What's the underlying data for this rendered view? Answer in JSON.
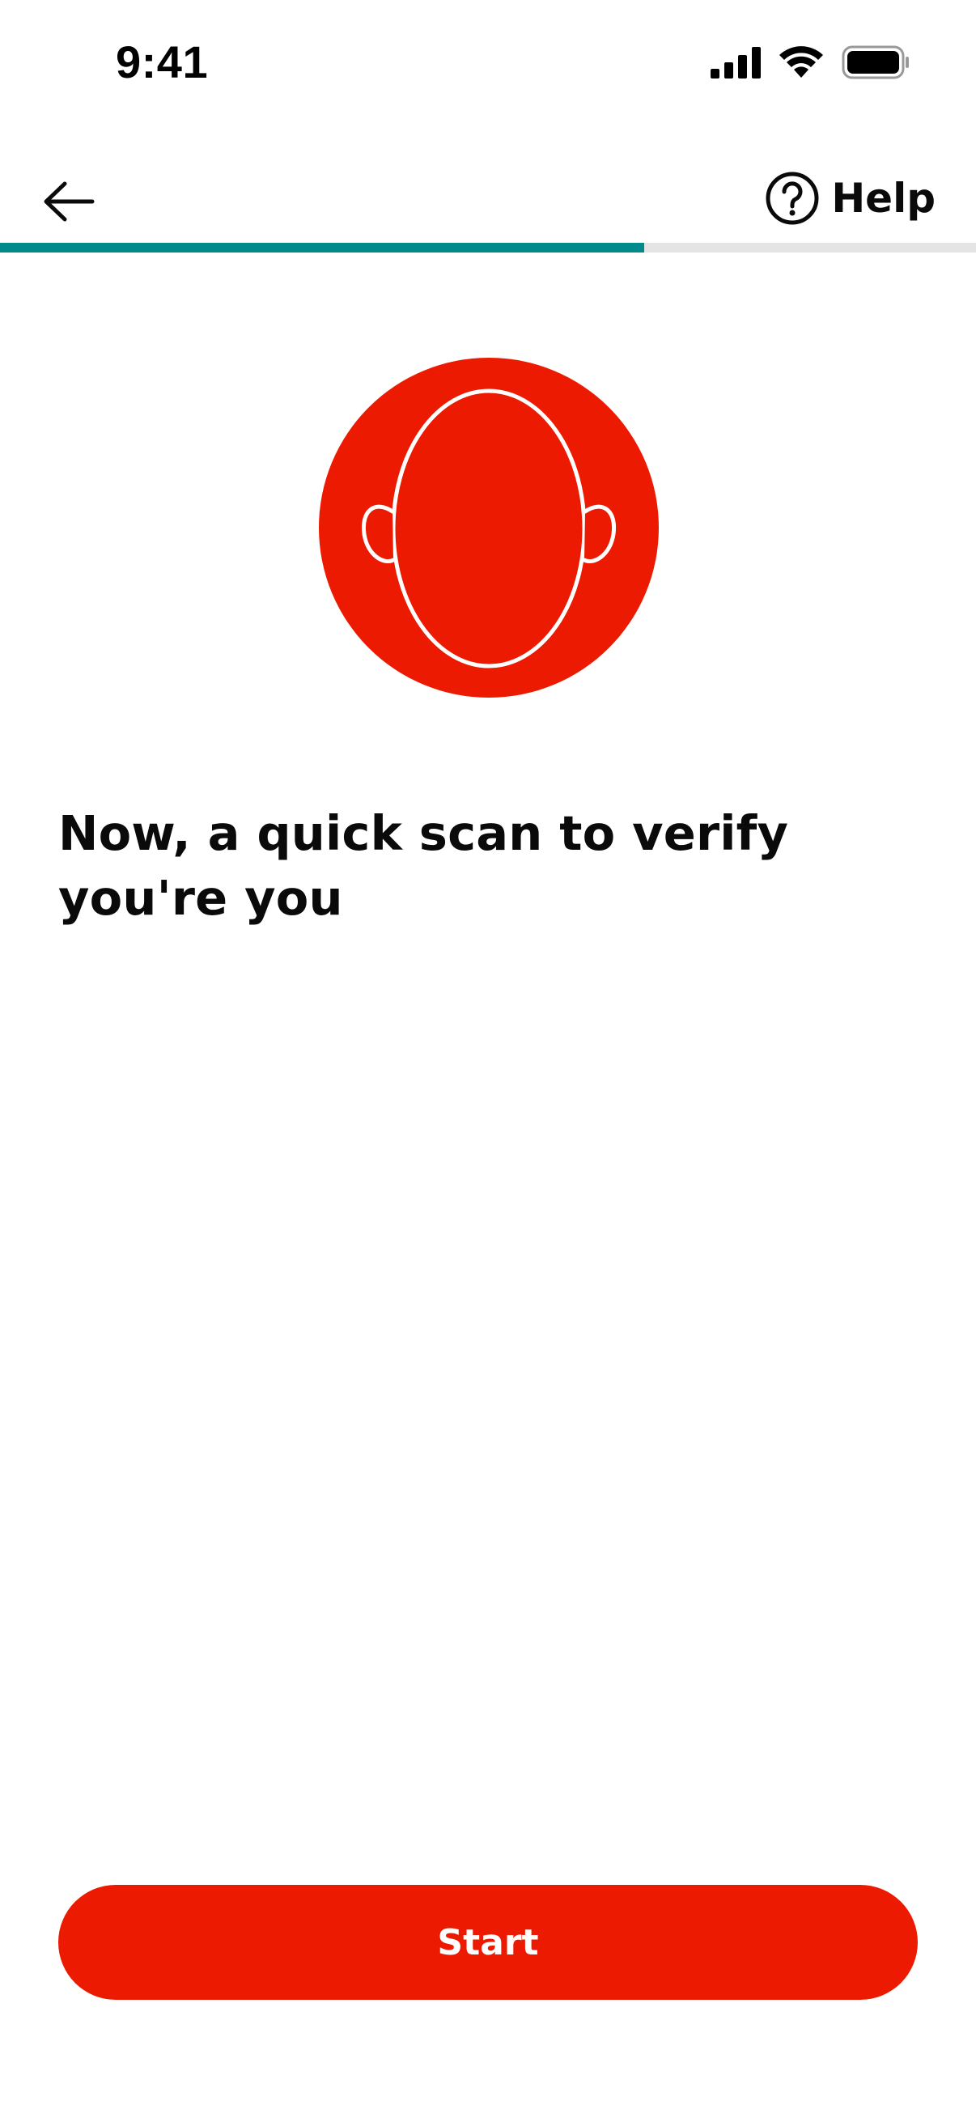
{
  "status_bar": {
    "time": "9:41",
    "icons": [
      "cellular-signal-icon",
      "wifi-icon",
      "battery-icon"
    ]
  },
  "nav": {
    "back_icon": "arrow-left-icon",
    "help_icon": "question-circle-icon",
    "help_label": "Help"
  },
  "progress": {
    "fraction": 0.66
  },
  "illustration": {
    "icon": "face-scan-icon"
  },
  "heading": "Now, a quick scan to verify you're you",
  "actions": {
    "start_label": "Start"
  },
  "colors": {
    "accent_red": "#ec1a00",
    "progress_teal": "#008a8a",
    "progress_track": "#e4e4e4",
    "text": "#0a0a0a",
    "background": "#ffffff"
  }
}
